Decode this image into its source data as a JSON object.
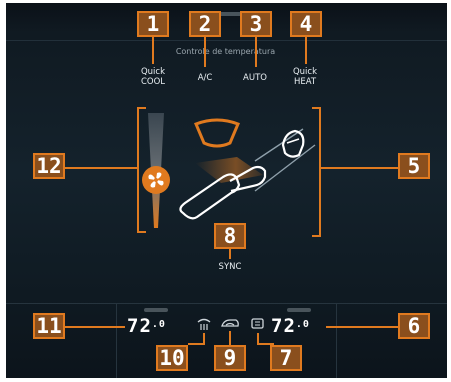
{
  "header": {
    "title": "Controle de temperatura"
  },
  "callouts": {
    "c1": "1",
    "c2": "2",
    "c3": "3",
    "c4": "4",
    "c5": "5",
    "c6": "6",
    "c7": "7",
    "c8": "8",
    "c9": "9",
    "c10": "10",
    "c11": "11",
    "c12": "12"
  },
  "modes": {
    "quick_cool": [
      "Quick",
      "COOL"
    ],
    "ac": "A/C",
    "auto": "AUTO",
    "quick_heat": [
      "Quick",
      "HEAT"
    ]
  },
  "sync_label": "SYNC",
  "driver_temp": {
    "value": "72",
    "decimal": ".0"
  },
  "passenger_temp": {
    "value": "72",
    "decimal": ".0"
  },
  "icons": {
    "fan": "fan-icon",
    "windshield": "windshield-defrost-icon",
    "seat": "seat-icon",
    "rear_defrost": "rear-defrost-icon",
    "recirculation": "recirculation-icon",
    "rear_window": "rear-window-icon"
  },
  "colors": {
    "accent": "#e07a1f",
    "callout_fill": "#8a4f1d",
    "background": "#14222c"
  }
}
